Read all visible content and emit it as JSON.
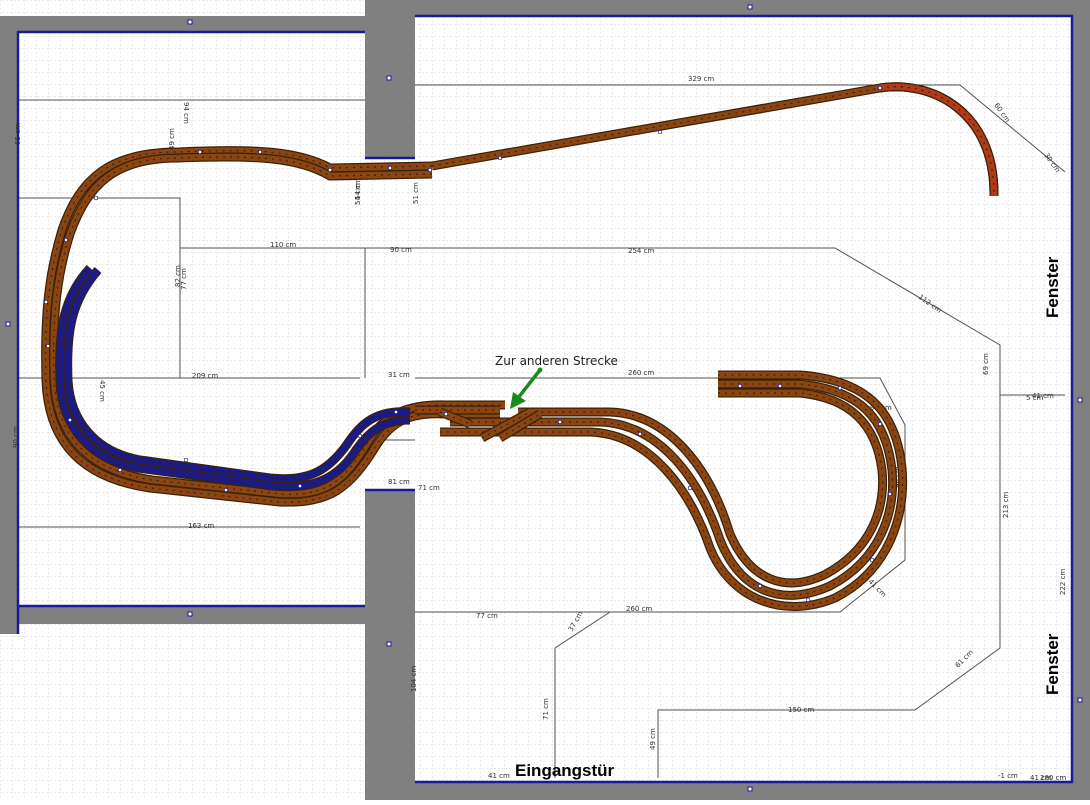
{
  "annotation": "Zur anderen Strecke",
  "labels": {
    "window_top": "Fenster",
    "window_bottom": "Fenster",
    "entrance_door": "Eingangstür"
  },
  "dimensions": [
    "329 cm",
    "110 cm",
    "254 cm",
    "209 cm",
    "31 cm",
    "260 cm",
    "112 cm",
    "260 cm",
    "150 cm",
    "81 cm",
    "213 cm",
    "222 cm",
    "41 cm",
    "41 cm",
    "82 cm",
    "54 cm",
    "77 cm",
    "51 cm",
    "94 cm",
    "65 cm",
    "90 cm",
    "45 cm",
    "37 cm",
    "61 cm",
    "69 cm",
    "90 cm",
    "163 cm",
    "280 cm",
    "104 cm",
    "71 cm",
    "49 cm",
    "49 cm",
    "41 cm",
    "60 cm",
    "30 cm",
    "93 cm",
    "96 cm",
    "41 cm",
    "-1 cm",
    "71 cm",
    "5 cm",
    "77 cm",
    "54 cm"
  ],
  "colors": {
    "track_main": "#8b4513",
    "track_dark": "#3a2208",
    "track_blue": "#1a1a8c",
    "track_red": "#b03a1a",
    "wall": "#808080",
    "wall_edge": "#1a1a99",
    "grid": "#c9c9c9",
    "outline": "#505050",
    "arrow": "#1a8a1a"
  }
}
